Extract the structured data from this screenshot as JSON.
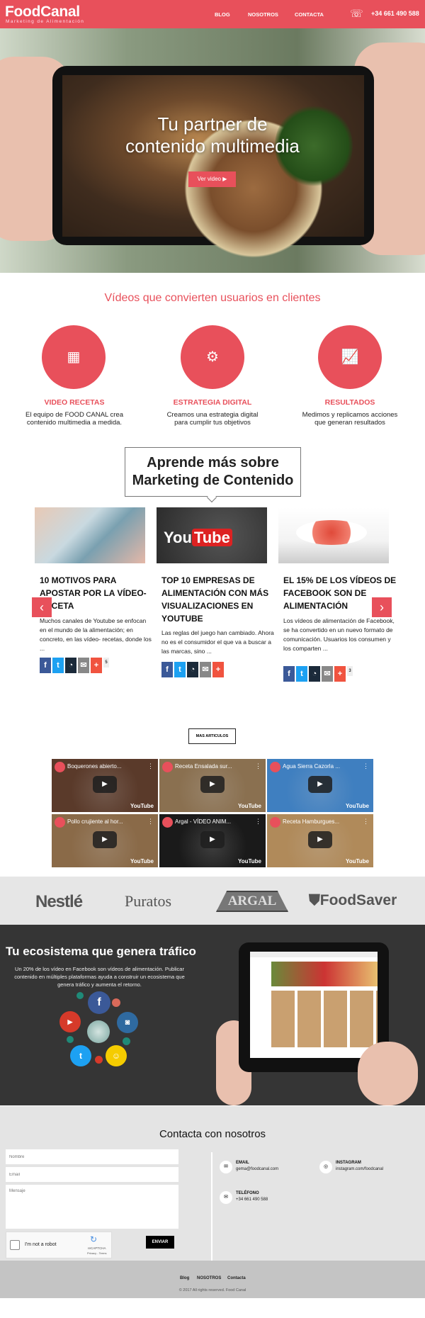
{
  "header": {
    "logo": "FoodCanal",
    "tagline": "Marketing de Alimentación",
    "nav": [
      "BLOG",
      "NOSOTROS",
      "CONTACTA"
    ],
    "phone": "+34 661 490 588"
  },
  "hero": {
    "title_line1": "Tu partner de",
    "title_line2": "contenido multimedia",
    "button": "Ver video"
  },
  "features": {
    "title": "Vídeos que convierten usuarios en clientes",
    "items": [
      {
        "label": "VIDEO RECETAS",
        "desc1": "El equipo de FOOD CANAL crea",
        "desc2": "contenido multimedia a medida.",
        "icon": "recipe-card-icon"
      },
      {
        "label": "ESTRATEGIA DIGITAL",
        "desc1": "Creamos una estrategia digital",
        "desc2": "para cumplir tus objetivos",
        "icon": "gears-icon"
      },
      {
        "label": "RESULTADOS",
        "desc1": "Medimos y replicamos acciones",
        "desc2": "que generan resultados",
        "icon": "growth-chart-icon"
      }
    ]
  },
  "blog": {
    "callout1": "Aprende más sobre",
    "callout2": "Marketing de Contenido",
    "more": "MAS ARTICULOS",
    "cards": [
      {
        "title": "10 MOTIVOS PARA APOSTAR POR LA VÍDEO-RECETA",
        "text": "Muchos canales de Youtube se enfocan en el mundo de la alimentación; en concreto, en las vídeo- recetas, donde los ...",
        "count": "5"
      },
      {
        "title": "TOP 10 EMPRESAS DE ALIMENTACIÓN CON MÁS VISUALIZACIONES EN YOUTUBE",
        "text": "Las reglas del juego han cambiado.  Ahora no es el consumidor el que va a buscar a las marcas, sino ...",
        "count": ""
      },
      {
        "title": "EL 15% DE LOS VÍDEOS DE FACEBOOK SON DE ALIMENTACIÓN",
        "text": "  Los vídeos de alimentación de  Facebook, se ha convertido en un nuevo formato de comunicación. Usuarios los consumen y los comparten ...",
        "count": "3"
      }
    ]
  },
  "videos": [
    {
      "title": "Boquerones abierto...",
      "bg": "#5a3a2a"
    },
    {
      "title": "Receta Ensalada sur...",
      "bg": "#8a7050"
    },
    {
      "title": "Agua Sierra Cazorla ...",
      "bg": "#3f7fc0"
    },
    {
      "title": "Pollo crujiente al hor...",
      "bg": "#8a6a48"
    },
    {
      "title": "Argal - VÍDEO ANIM...",
      "bg": "#1a1a1a"
    },
    {
      "title": "Receta Hamburgues...",
      "bg": "#b08a5a"
    }
  ],
  "youtube_label": "YouTube",
  "brands": [
    "Nestlé",
    "Puratos",
    "ARGAL",
    "FoodSaver"
  ],
  "ecosystem": {
    "title": "Tu ecosistema que genera tráfico",
    "text": "Un 20% de los vídeo en Facebook son vídeos de alimentación. Publicar contenido en múltiples plataformas ayuda a construir un ecosistema que genera tráfico y aumenta el retorno."
  },
  "contact": {
    "title": "Contacta con nosotros",
    "name_ph": "Nombre",
    "email_ph": "Email",
    "msg_ph": "Mensaje",
    "captcha": "I'm not a robot",
    "recaptcha": "reCAPTCHA",
    "recaptcha_links": "Privacy - Terms",
    "send": "ENVIAR",
    "email_label": "EMAIL",
    "email": "gema@foodcanal.com",
    "insta_label": "INSTAGRAM",
    "insta": "instagram.com/foodcanal",
    "tel_label": "TELÉFONO",
    "tel": "+34 661 490 588"
  },
  "footer": {
    "links": [
      "Blog",
      "NOSOTROS",
      "Contacta"
    ],
    "copyright": "© 2017 All rights reserved. Food Canal"
  },
  "colors": {
    "accent": "#e8505b",
    "dark": "#353535"
  }
}
